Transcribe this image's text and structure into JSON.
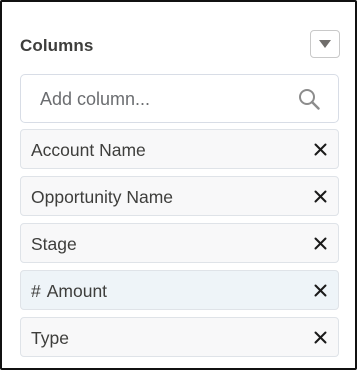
{
  "panel": {
    "title": "Columns",
    "toggle_icon": "chevron-down-icon"
  },
  "search": {
    "placeholder": "Add column...",
    "icon": "search-icon"
  },
  "columns": [
    {
      "label": "Account Name",
      "type_symbol": "",
      "remove_icon": "close-icon"
    },
    {
      "label": "Opportunity Name",
      "type_symbol": "",
      "remove_icon": "close-icon"
    },
    {
      "label": "Stage",
      "type_symbol": "",
      "remove_icon": "close-icon"
    },
    {
      "label": "Amount",
      "type_symbol": "#",
      "remove_icon": "close-icon"
    },
    {
      "label": "Type",
      "type_symbol": "",
      "remove_icon": "close-icon"
    }
  ],
  "colors": {
    "text": "#3e3e3c",
    "border": "#dfe3e8",
    "item_bg": "#f8f8f9",
    "numeric_item_bg": "#eef4f8",
    "icon_gray": "#706e6b"
  }
}
